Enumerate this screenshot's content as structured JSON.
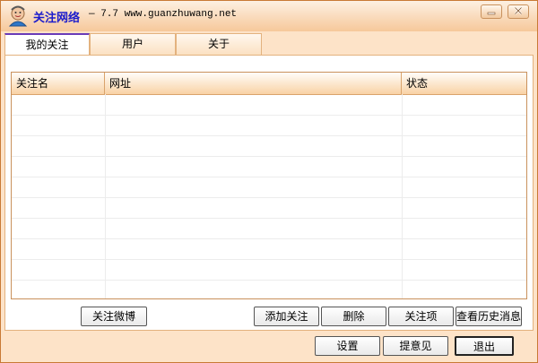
{
  "window": {
    "title": "关注网络",
    "subtitle": "— 7.7 www.guanzhuwang.net",
    "accent_color": "#1c1ccc",
    "min_icon": "minimize-icon",
    "close_icon": "close-icon"
  },
  "tabs": [
    {
      "label": "我的关注",
      "active": true
    },
    {
      "label": "用户",
      "active": false
    },
    {
      "label": "关于",
      "active": false
    }
  ],
  "table": {
    "columns": [
      "关注名",
      "网址",
      "状态"
    ],
    "rows": []
  },
  "actions": {
    "follow_weibo": "关注微博",
    "add_follow": "添加关注",
    "delete": "删除",
    "follow_items": "关注项",
    "view_history": "查看历史消息"
  },
  "footer": {
    "settings": "设置",
    "feedback": "提意见",
    "exit": "退出"
  }
}
